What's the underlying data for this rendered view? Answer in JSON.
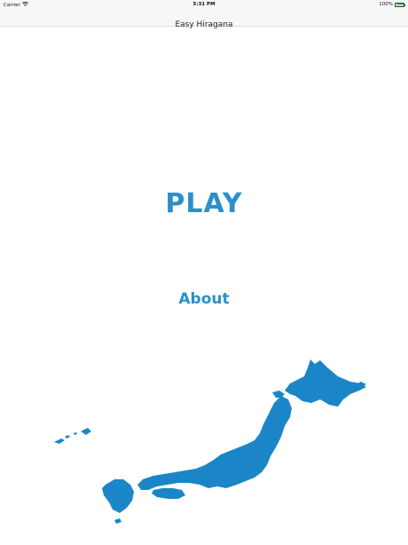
{
  "status_bar": {
    "carrier": "Carrier",
    "time": "5:31 PM",
    "battery_percent": "100%",
    "battery_level": 1.0
  },
  "nav": {
    "title": "Easy Hiragana"
  },
  "main": {
    "play_label": "PLAY",
    "about_label": "About"
  },
  "colors": {
    "accent": "#2b8fc9",
    "map": "#1a86c8"
  },
  "icons": {
    "wifi": "wifi-icon",
    "battery": "battery-icon",
    "map": "japan-map-icon"
  }
}
